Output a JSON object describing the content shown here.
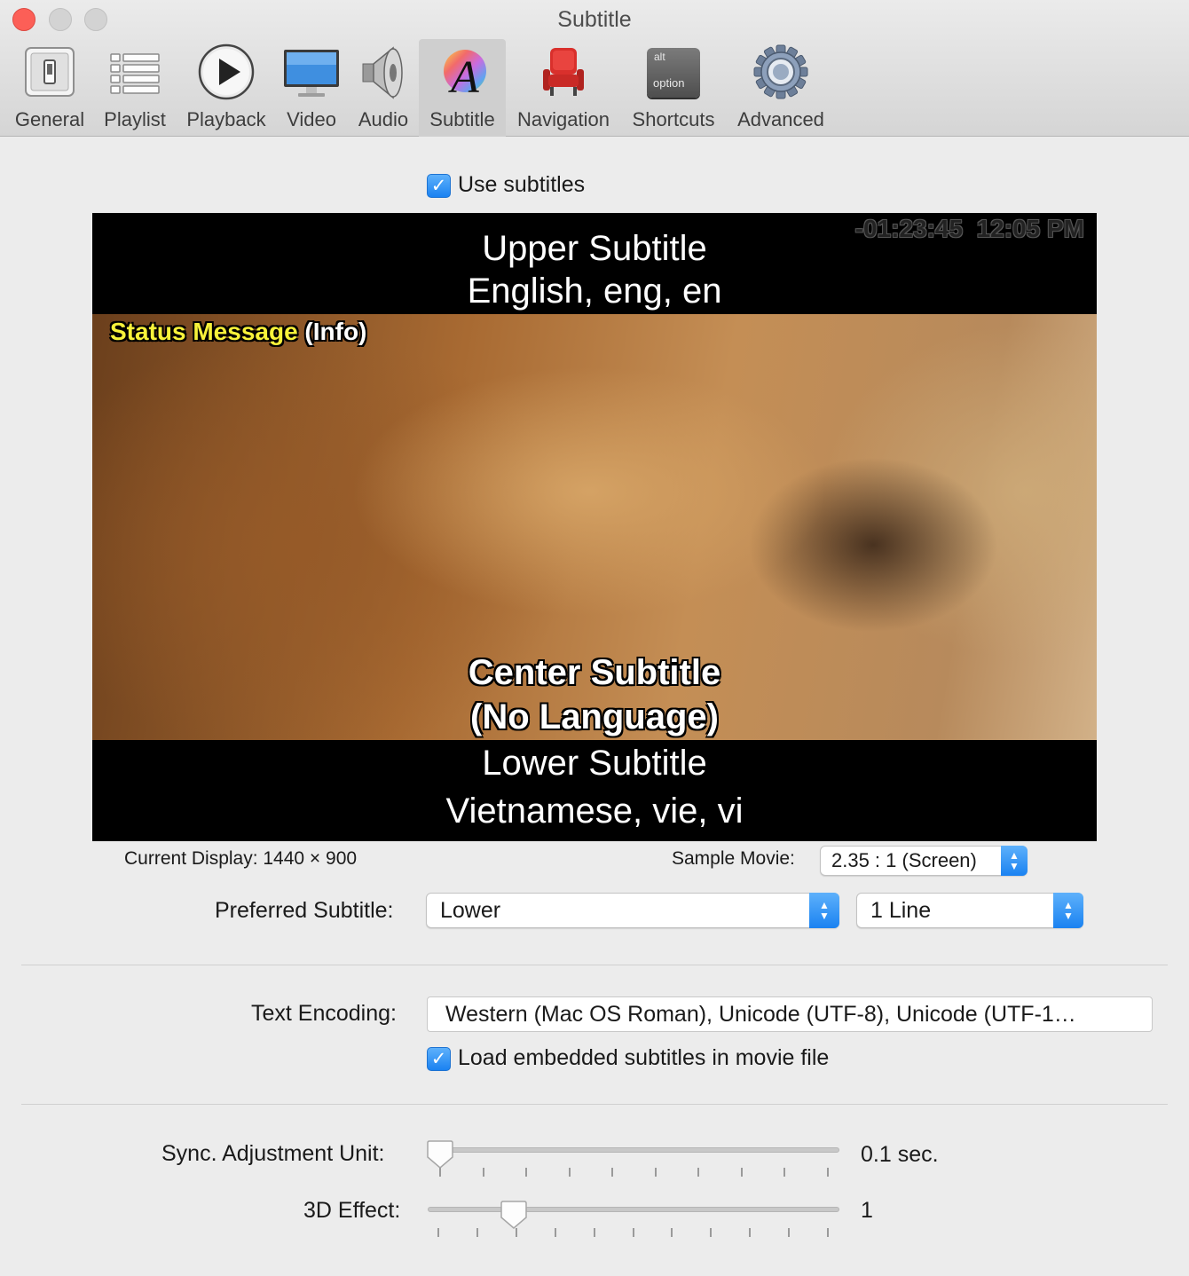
{
  "window": {
    "title": "Subtitle"
  },
  "toolbar": {
    "items": [
      {
        "label": "General",
        "icon": "general-switch-icon"
      },
      {
        "label": "Playlist",
        "icon": "playlist-icon"
      },
      {
        "label": "Playback",
        "icon": "play-icon"
      },
      {
        "label": "Video",
        "icon": "monitor-icon"
      },
      {
        "label": "Audio",
        "icon": "speaker-icon"
      },
      {
        "label": "Subtitle",
        "icon": "subtitle-a-icon",
        "selected": true
      },
      {
        "label": "Navigation",
        "icon": "theater-seat-icon"
      },
      {
        "label": "Shortcuts",
        "icon": "option-key-icon"
      },
      {
        "label": "Advanced",
        "icon": "gear-icon"
      }
    ],
    "key_top": "alt",
    "key_bottom": "option"
  },
  "use_subtitles": {
    "label": "Use subtitles",
    "checked": true
  },
  "preview": {
    "time": "-01:23:45",
    "clock": "12:05 PM",
    "upper_line1": "Upper Subtitle",
    "upper_line2": "English, eng, en",
    "status_message": "Status Message",
    "status_info": "(Info)",
    "center_line1": "Center Subtitle",
    "center_line2": "(No Language)",
    "lower_line1": "Lower Subtitle",
    "lower_line2": "Vietnamese, vie, vi"
  },
  "current_display": "Current Display: 1440 × 900",
  "sample_movie": {
    "label": "Sample Movie:",
    "value": "2.35 : 1 (Screen)"
  },
  "preferred_subtitle": {
    "label": "Preferred Subtitle:",
    "position": "Lower",
    "lines": "1 Line"
  },
  "text_encoding": {
    "label": "Text Encoding:",
    "value": "Western (Mac OS Roman), Unicode (UTF-8), Unicode (UTF-1…"
  },
  "load_embedded": {
    "label": "Load embedded subtitles in movie file",
    "checked": true
  },
  "sync_adjustment": {
    "label": "Sync. Adjustment Unit:",
    "value": "0.1 sec.",
    "position": 0.0
  },
  "effect_3d": {
    "label": "3D Effect:",
    "value": "1",
    "position": 0.2
  },
  "colors": {
    "accent": "#1a82f1",
    "close": "#fc5f57",
    "status_yellow": "#f7f23a"
  }
}
